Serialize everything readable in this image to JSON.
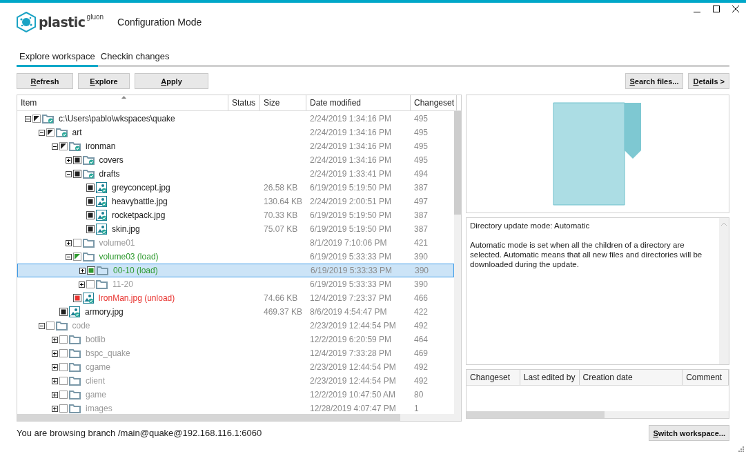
{
  "app": {
    "logo_text": "plastic",
    "logo_suffix": "gluon",
    "mode": "Configuration Mode"
  },
  "tabs": [
    {
      "label": "Explore workspace",
      "selected": true
    },
    {
      "label": "Checkin changes",
      "selected": false
    }
  ],
  "toolbar_left": [
    "Refresh",
    "Explore",
    "Apply"
  ],
  "toolbar_right": [
    "Search files...",
    "Details >"
  ],
  "tree": {
    "columns": [
      "Item",
      "Status",
      "Size",
      "Date modified",
      "Changeset"
    ],
    "rows": [
      {
        "name": "c:\\Users\\pablo\\wkspaces\\quake",
        "kind": "folder",
        "synced": true,
        "color": "#222222",
        "checked": false,
        "partial": true,
        "expanded": true,
        "selected": false,
        "date": "2/24/2019 1:34:16 PM",
        "changeset": "495",
        "children": [
          {
            "name": "art",
            "kind": "folder",
            "synced": true,
            "color": "#222222",
            "checked": false,
            "partial": true,
            "expanded": true,
            "selected": false,
            "date": "2/24/2019 1:34:16 PM",
            "changeset": "495",
            "children": [
              {
                "name": "ironman",
                "kind": "folder",
                "synced": true,
                "color": "#222222",
                "checked": false,
                "partial": true,
                "expanded": true,
                "selected": false,
                "date": "2/24/2019 1:34:16 PM",
                "changeset": "495",
                "children": [
                  {
                    "name": "covers",
                    "kind": "folder",
                    "synced": true,
                    "color": "#222222",
                    "checked": true,
                    "partial": false,
                    "expanded": false,
                    "selected": false,
                    "date": "2/24/2019 1:34:16 PM",
                    "changeset": "495"
                  },
                  {
                    "name": "drafts",
                    "kind": "folder",
                    "synced": true,
                    "color": "#222222",
                    "checked": true,
                    "partial": false,
                    "expanded": true,
                    "selected": false,
                    "date": "2/24/2019 1:33:41 PM",
                    "changeset": "494",
                    "children": [
                      {
                        "name": "greyconcept.jpg",
                        "kind": "image",
                        "synced": true,
                        "color": "#222222",
                        "checked": true,
                        "partial": false,
                        "selected": false,
                        "size": "26.58 KB",
                        "date": "6/19/2019 5:19:50 PM",
                        "changeset": "387"
                      },
                      {
                        "name": "heavybattle.jpg",
                        "kind": "image",
                        "synced": true,
                        "color": "#222222",
                        "checked": true,
                        "partial": false,
                        "selected": false,
                        "size": "130.64 KB",
                        "date": "2/24/2019 2:00:51 PM",
                        "changeset": "497"
                      },
                      {
                        "name": "rocketpack.jpg",
                        "kind": "image",
                        "synced": true,
                        "color": "#222222",
                        "checked": true,
                        "partial": false,
                        "selected": false,
                        "size": "70.33 KB",
                        "date": "6/19/2019 5:19:50 PM",
                        "changeset": "387"
                      },
                      {
                        "name": "skin.jpg",
                        "kind": "image",
                        "synced": true,
                        "color": "#222222",
                        "checked": true,
                        "partial": false,
                        "selected": false,
                        "size": "75.07 KB",
                        "date": "6/19/2019 5:19:50 PM",
                        "changeset": "387"
                      }
                    ]
                  },
                  {
                    "name": "volume01",
                    "kind": "folder",
                    "synced": false,
                    "color": "#9a9a9a",
                    "checked": false,
                    "partial": false,
                    "expanded": false,
                    "selected": false,
                    "date": "8/1/2019 7:10:06 PM",
                    "changeset": "421"
                  },
                  {
                    "name": "volume03 (load)",
                    "kind": "folder",
                    "synced": false,
                    "color": "#2f9a2f",
                    "checked": false,
                    "partial": true,
                    "expanded": true,
                    "selected": false,
                    "date": "6/19/2019 5:33:33 PM",
                    "changeset": "390",
                    "children": [
                      {
                        "name": "00-10 (load)",
                        "kind": "folder",
                        "synced": false,
                        "color": "#2f9a2f",
                        "checked": true,
                        "partial": false,
                        "expanded": false,
                        "selected": true,
                        "date": "6/19/2019 5:33:33 PM",
                        "changeset": "390"
                      },
                      {
                        "name": "11-20",
                        "kind": "folder",
                        "synced": false,
                        "color": "#9a9a9a",
                        "checked": false,
                        "partial": false,
                        "expanded": false,
                        "selected": false,
                        "date": "6/19/2019 5:33:33 PM",
                        "changeset": "390"
                      }
                    ]
                  },
                  {
                    "name": "IronMan.jpg (unload)",
                    "kind": "image",
                    "synced": true,
                    "color": "#e8322e",
                    "checked": true,
                    "partial": false,
                    "selected": false,
                    "size": "74.66 KB",
                    "date": "12/4/2019 7:23:37 PM",
                    "changeset": "466"
                  }
                ]
              },
              {
                "name": "armory.jpg",
                "kind": "image",
                "synced": true,
                "color": "#222222",
                "checked": true,
                "partial": false,
                "selected": false,
                "size": "469.37 KB",
                "date": "8/6/2019 4:54:47 PM",
                "changeset": "422"
              }
            ]
          },
          {
            "name": "code",
            "kind": "folder",
            "synced": false,
            "color": "#9a9a9a",
            "checked": false,
            "partial": false,
            "expanded": true,
            "selected": false,
            "date": "2/23/2019 12:44:54 PM",
            "changeset": "492",
            "children": [
              {
                "name": "botlib",
                "kind": "folder",
                "synced": false,
                "color": "#9a9a9a",
                "checked": false,
                "partial": false,
                "expanded": false,
                "selected": false,
                "date": "12/2/2019 6:20:59 PM",
                "changeset": "464"
              },
              {
                "name": "bspc_quake",
                "kind": "folder",
                "synced": false,
                "color": "#9a9a9a",
                "checked": false,
                "partial": false,
                "expanded": false,
                "selected": false,
                "date": "12/4/2019 7:33:28 PM",
                "changeset": "469"
              },
              {
                "name": "cgame",
                "kind": "folder",
                "synced": false,
                "color": "#9a9a9a",
                "checked": false,
                "partial": false,
                "expanded": false,
                "selected": false,
                "date": "2/23/2019 12:44:54 PM",
                "changeset": "492"
              },
              {
                "name": "client",
                "kind": "folder",
                "synced": false,
                "color": "#9a9a9a",
                "checked": false,
                "partial": false,
                "expanded": false,
                "selected": false,
                "date": "2/23/2019 12:44:54 PM",
                "changeset": "492"
              },
              {
                "name": "game",
                "kind": "folder",
                "synced": false,
                "color": "#9a9a9a",
                "checked": false,
                "partial": false,
                "expanded": false,
                "selected": false,
                "date": "12/2/2019 10:47:50 AM",
                "changeset": "80"
              },
              {
                "name": "images",
                "kind": "folder",
                "synced": false,
                "color": "#9a9a9a",
                "checked": false,
                "partial": false,
                "expanded": false,
                "selected": false,
                "date": "12/28/2019 4:07:47 PM",
                "changeset": "1"
              }
            ]
          }
        ]
      }
    ]
  },
  "details": {
    "title": "Directory update mode: Automatic",
    "description": "Automatic mode is set when all the children of a directory are selected. Automatic means that all new files and directories will be downloaded during the update."
  },
  "history": {
    "columns": [
      "Changeset",
      "Last edited by",
      "Creation date",
      "Comment"
    ]
  },
  "status_bar": "You are browsing branch /main@quake@192.168.116.1:6060",
  "footer_button": "Switch workspace..."
}
